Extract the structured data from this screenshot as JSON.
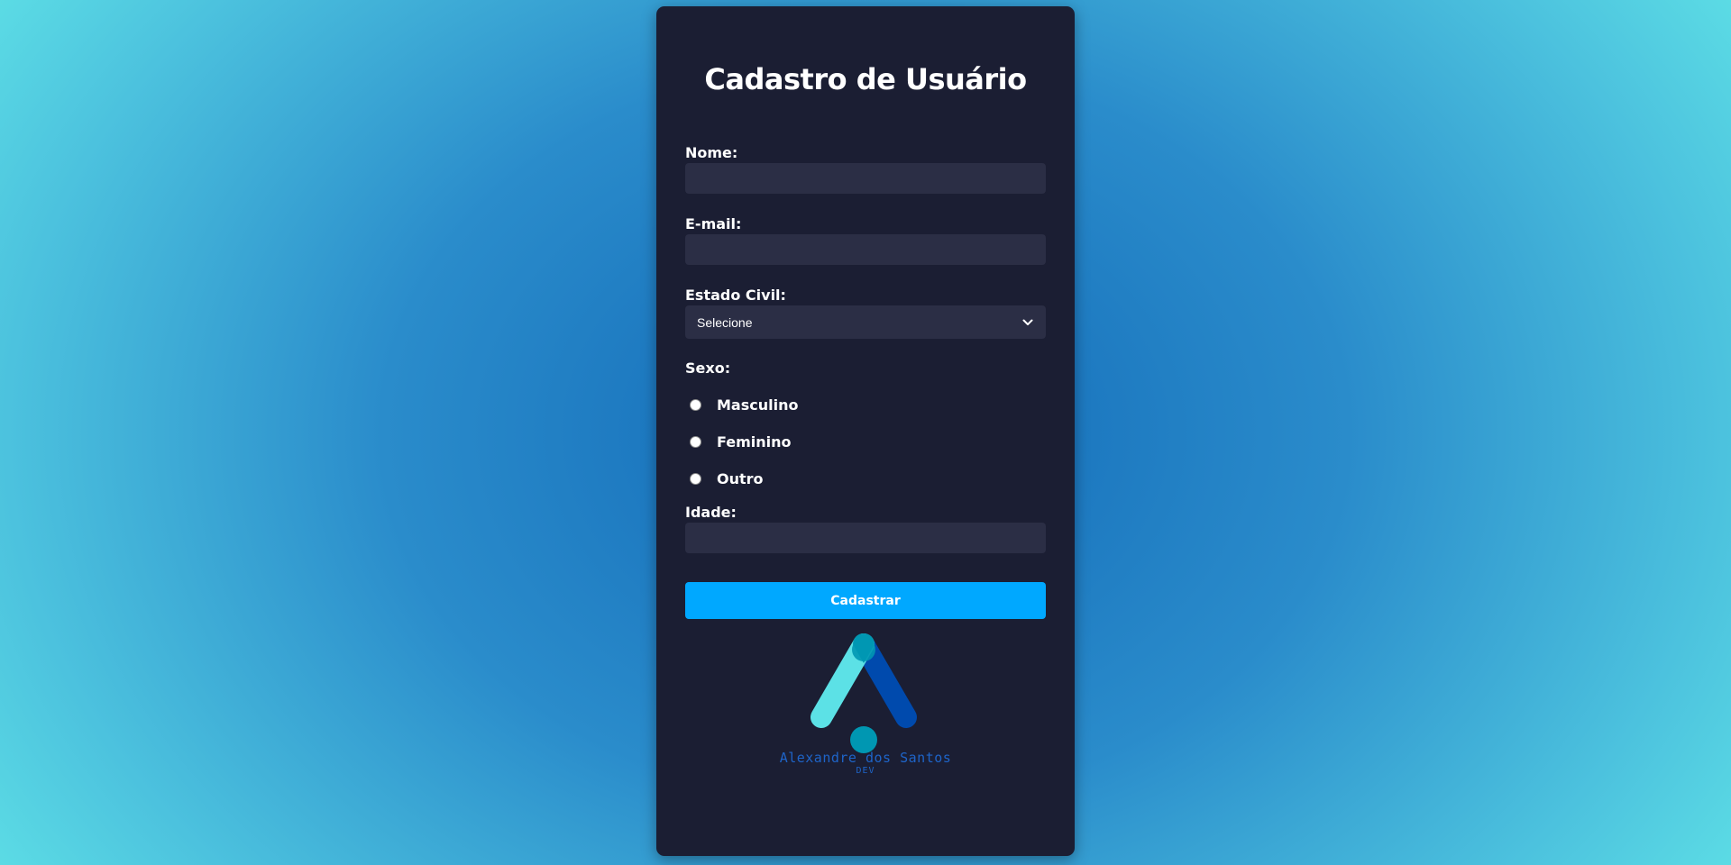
{
  "form": {
    "title": "Cadastro de Usuário",
    "nome_label": "Nome:",
    "nome_value": "",
    "email_label": "E-mail:",
    "email_value": "",
    "estado_civil_label": "Estado Civil:",
    "estado_civil_selected": "Selecione",
    "sexo_label": "Sexo:",
    "sexo_options": [
      {
        "label": "Masculino",
        "checked": false
      },
      {
        "label": "Feminino",
        "checked": false
      },
      {
        "label": "Outro",
        "checked": false
      }
    ],
    "idade_label": "Idade:",
    "idade_value": "",
    "submit_label": "Cadastrar"
  },
  "logo": {
    "name": "Alexandre dos Santos",
    "subtitle": "DEV",
    "colors": {
      "light": "#5ce1e6",
      "dark": "#004aad",
      "dot": "#0097b2"
    }
  },
  "colors": {
    "card_bg": "#1b1e33",
    "input_bg": "#2b2e45",
    "button_bg": "#00a8ff",
    "background_center": "#136ab8",
    "background_edge": "#5fe1e6"
  },
  "icons": {
    "select_arrow": "chevron-down-icon"
  }
}
